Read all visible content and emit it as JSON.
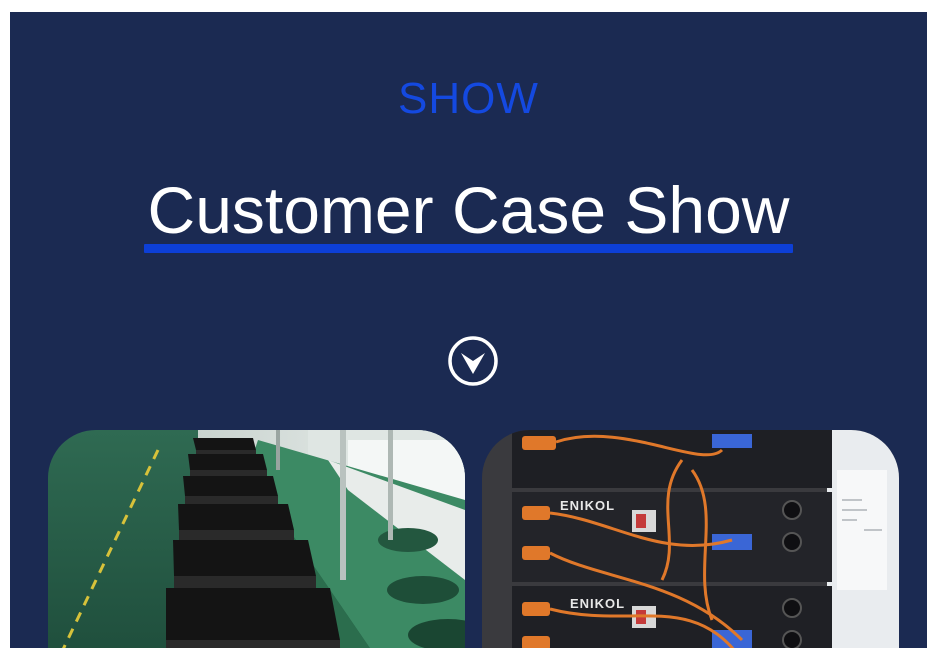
{
  "section": {
    "kicker": "SHOW",
    "title": "Customer Case Show",
    "scroll_icon": "chevron-down-circle-icon"
  },
  "photos": [
    {
      "subject": "factory-production-line-battery-boxes"
    },
    {
      "subject": "rack-mounted-battery-modules",
      "brand_text": "ENIKOL"
    }
  ],
  "colors": {
    "panel_bg": "#1b2a52",
    "accent_blue": "#1449e0",
    "title_text": "#ffffff",
    "cable_orange": "#e0782a"
  }
}
